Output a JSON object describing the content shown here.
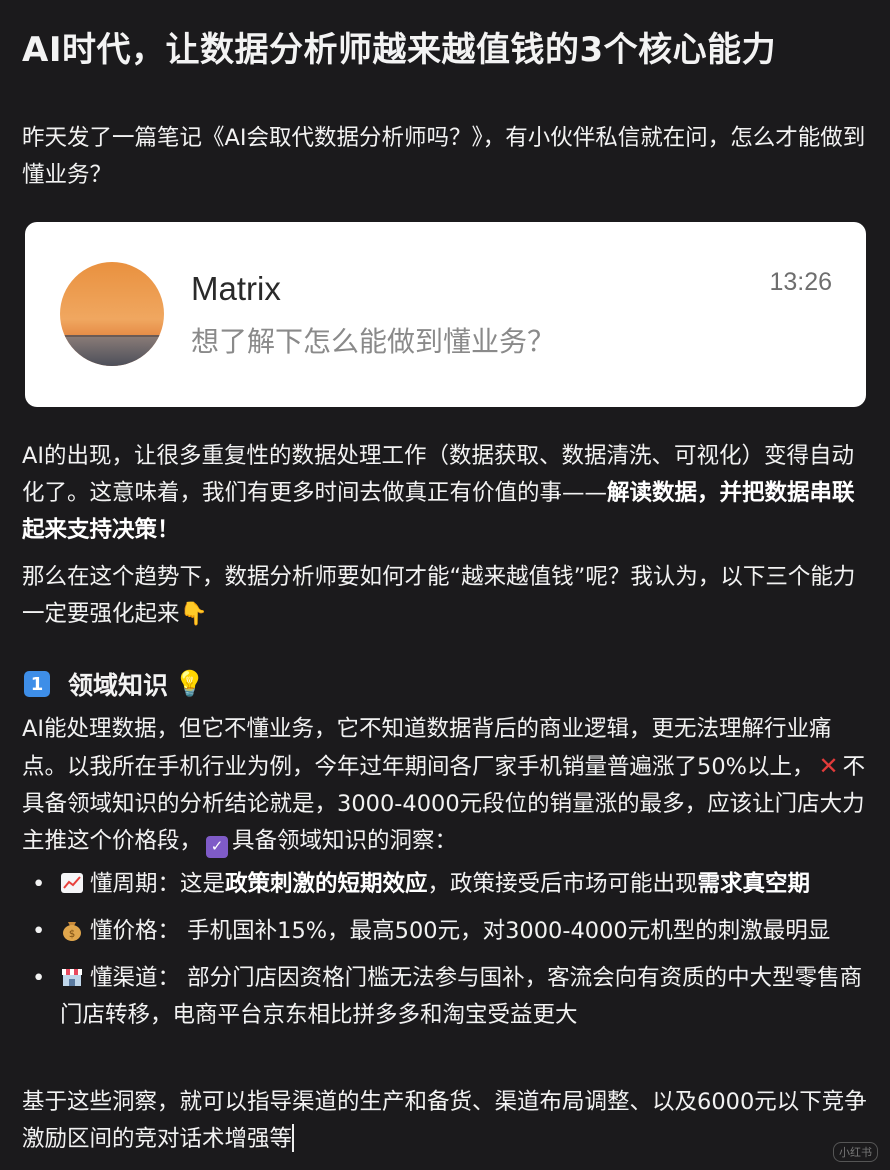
{
  "title": "AI时代，让数据分析师越来越值钱的3个核心能力",
  "intro": {
    "text": "昨天发了一篇笔记《AI会取代数据分析师吗？》，有小伙伴私信就在问，怎么才能做到懂业务？"
  },
  "message_card": {
    "name": "Matrix",
    "time": "13:26",
    "message": "想了解下怎么能做到懂业务？",
    "avatar": "sunset-sea-avatar"
  },
  "para2": {
    "text_a": "AI的出现，让很多重复性的数据处理工作（数据获取、数据清洗、可视化）变得自动化了。这意味着，我们有更多时间去做真正有价值的事——",
    "bold": "解读数据，并把数据串联起来支持决策！"
  },
  "para3": {
    "text": "那么在这个趋势下，数据分析师要如何才能“越来越值钱”呢？我认为，以下三个能力一定要强化起来",
    "emoji": "👇"
  },
  "section1": {
    "badge": "1",
    "title": "领域知识",
    "emoji": "💡"
  },
  "para4": {
    "text_a": " AI能处理数据，但它不懂业务，它不知道数据背后的商业逻辑，更无法理解行业痛点。以我所在手机行业为例，今年过年期间各厂家手机销量普遍涨了50%以上，",
    "cross": "✕",
    "text_b": "不具备领域知识的分析结论就是，3000-4000元段位的销量涨的最多，应该让门店大力主推这个价格段，",
    "check": "✓",
    "text_c": "具备领域知识的洞察："
  },
  "bullets": [
    {
      "icon": "chart-up-icon",
      "prefix": "懂周期：这是",
      "bold1": "政策刺激的短期效应",
      "middle": "，政策接受后市场可能出现",
      "bold2": "需求真空期"
    },
    {
      "icon": "money-bag-icon",
      "prefix": "懂价格： 手机国补15%，最高500元，对3000-4000元机型的刺激最明显",
      "bold1": "",
      "middle": "",
      "bold2": ""
    },
    {
      "icon": "store-icon",
      "prefix": "懂渠道： 部分门店因资格门槛无法参与国补，客流会向有资质的中大型零售商门店转移，电商平台京东相比拼多多和淘宝受益更大",
      "bold1": "",
      "middle": "",
      "bold2": ""
    }
  ],
  "bullet_dot": "•",
  "para5": {
    "text": "基于这些洞察，就可以指导渠道的生产和备货、渠道布局调整、以及6000元以下竞争激励区间的竞对话术增强等"
  },
  "watermark": "小红书",
  "colors": {
    "background": "#1b1a1c",
    "card": "#ffffff",
    "badge": "#3e8ee8",
    "cross": "#e23b3b",
    "check": "#7f5bc7"
  }
}
